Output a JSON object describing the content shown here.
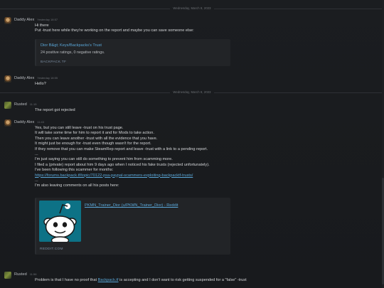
{
  "dividers": {
    "first": "Wednesday, March 8, 2023",
    "second": "Wednesday, March 8, 2023"
  },
  "messages": {
    "m1": {
      "author": "Daddy Alex",
      "time": "Yesterday 18:57",
      "lines": [
        "Hi there",
        "Put -trust here while they're working on the report and maybe you can save someone else:"
      ],
      "embed": {
        "title": "Dior B&gt; Keys/Backpacks's Trust",
        "desc": "24 positive ratings, 0 negative ratings.",
        "provider": "BACKPACK.TF"
      }
    },
    "m2": {
      "author": "Daddy Alex",
      "time": "Yesterday 18:55",
      "lines": [
        "Hello?"
      ]
    },
    "m3": {
      "author": "Rusted",
      "time": "11:15",
      "lines": [
        "The report got rejected"
      ]
    },
    "m4": {
      "author": "Daddy Alex",
      "time": "11:43",
      "lines": [
        "Yes, but you can still leave -trust on his trust page.",
        "It will take some time for him to report it and for Mods to take action.",
        "Then you can leave another -trust with all the evidence that you have.",
        "It might just be enough for -trust even though wasn't for the report.",
        "If they remove that you can make SteamRep report and leave -trust with a link to a pending report.",
        "...",
        "I'm just saying you can still do something to prevent him from scamming more.",
        "I filed a (private) report about him 9 days ago when I noticed his fake trusts (rejected unfortunately).",
        "I've been following this scammer for months:"
      ],
      "link": "https://forums.backpack.tf/topic/70122-psa-paypal-scammers-exploiting-backpacktf-trusts/",
      "after_link": [
        "...",
        "I'm also leaving comments on all his posts here:"
      ],
      "embed": {
        "title": "PKMN_Trainer_Dior (u/PKMN_Trainer_Dior) - Reddit",
        "provider": "REDDIT.COM"
      }
    },
    "m5": {
      "author": "Rusted",
      "time": "11:56",
      "text_before": "Problem is that I have no proof that ",
      "link": "Backpack.tf",
      "text_after": " is accepting and I don't want to risk getting suspended for a \"false\" -trust"
    }
  },
  "colors": {
    "background": "#1b1d20",
    "link": "#5aa7d8",
    "reddit_thumb": "#0d7286"
  },
  "icons": {
    "alex_avatar": "dog-avatar",
    "rusted_avatar": "green-avatar",
    "reddit_logo": "reddit-snoo-icon"
  }
}
